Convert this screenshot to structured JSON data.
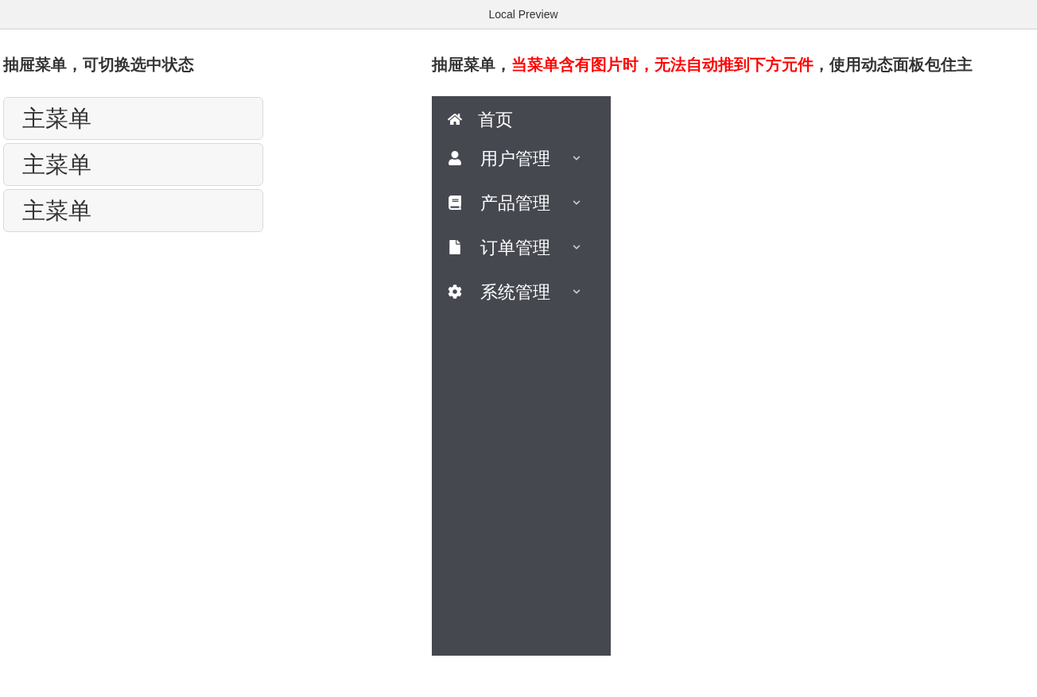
{
  "window": {
    "title": "Local Preview"
  },
  "left_section": {
    "heading": "抽屉菜单，可切换选中状态",
    "menus": [
      {
        "label": "主菜单"
      },
      {
        "label": "主菜单"
      },
      {
        "label": "主菜单"
      }
    ]
  },
  "right_section": {
    "heading": [
      {
        "text": "抽屉菜单，",
        "kind": "plain"
      },
      {
        "text": "当菜单含有图片时，无法自动推到下方元件",
        "kind": "warning"
      },
      {
        "text": "，使用动态面板包住主",
        "kind": "plain"
      }
    ],
    "sidebar": {
      "items": [
        {
          "label": "首页",
          "kind": "link"
        },
        {
          "label": "用户管理",
          "kind": "submenu"
        },
        {
          "label": "产品管理",
          "kind": "submenu"
        },
        {
          "label": "订单管理",
          "kind": "submenu"
        },
        {
          "label": "系统管理",
          "kind": "submenu"
        }
      ]
    }
  }
}
